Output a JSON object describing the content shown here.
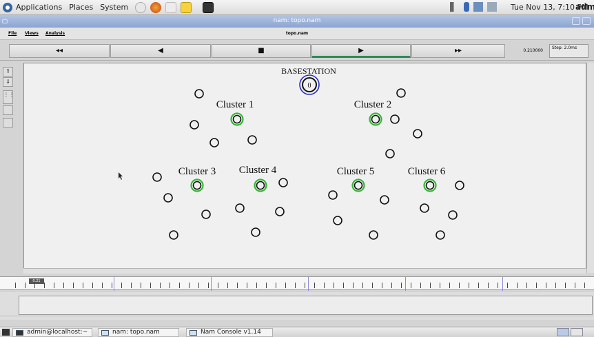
{
  "top_panel": {
    "menus": [
      "Applications",
      "Places",
      "System"
    ],
    "clock": "Tue Nov 13, 7:10 PM",
    "user": "admi"
  },
  "window": {
    "title": "nam: topo.nam"
  },
  "nam_menu": {
    "file": "File",
    "views": "Views",
    "analysis": "Analysis",
    "file_title": "topo.nam"
  },
  "controls": {
    "rewind": "◂◂",
    "back": "◀",
    "stop": "■",
    "play": "▶",
    "fast_forward": "▸▸",
    "time": "0.210000",
    "step": "Step: 2.0ms"
  },
  "network": {
    "basestation_label": "BASESTATION",
    "basestation_node": "0",
    "cluster_labels": [
      "Cluster 1",
      "Cluster 2",
      "Cluster 3",
      "Cluster 4",
      "Cluster 5",
      "Cluster 6"
    ],
    "basestation_ring_color": "#2c2cc8",
    "cluster_head_ring_color": "#33b833",
    "node_color": "#111111"
  },
  "timeline": {
    "marker": "0.21"
  },
  "taskbar": {
    "items": [
      "admin@localhost:~",
      "nam: topo.nam",
      "Nam Console v1.14"
    ]
  }
}
